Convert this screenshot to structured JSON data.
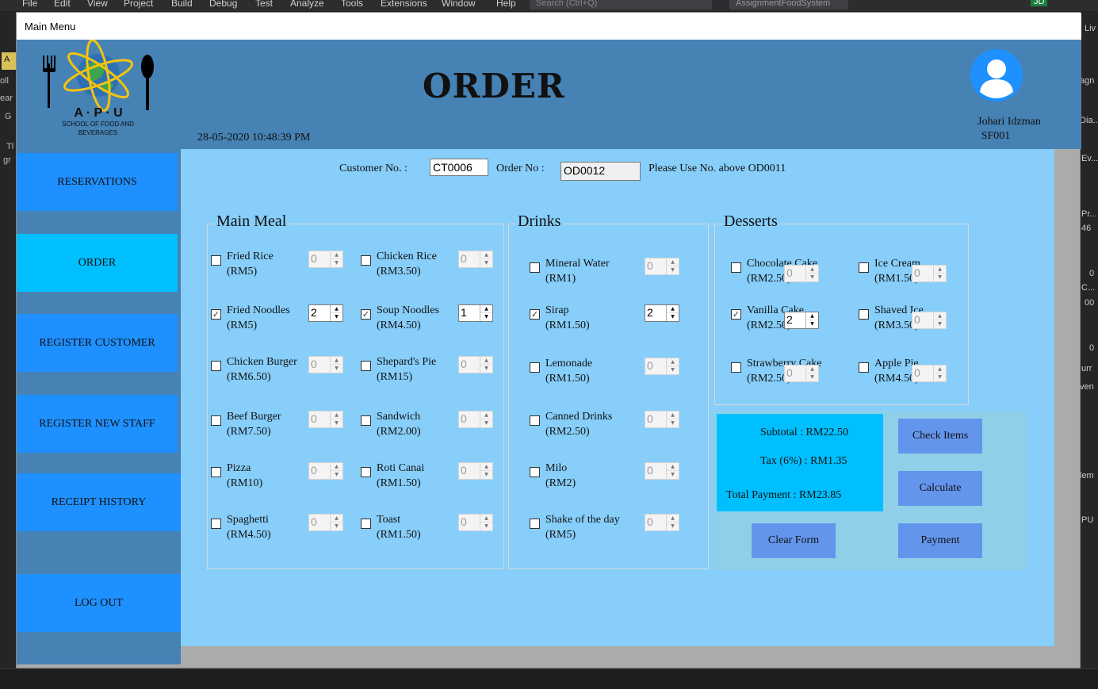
{
  "ide": {
    "menu": [
      "File",
      "Edit",
      "View",
      "Project",
      "Build",
      "Debug",
      "Test",
      "Analyze",
      "Tools",
      "Extensions",
      "Window",
      "Help"
    ],
    "search_placeholder": "Search (Ctrl+Q)",
    "project_name": "AssignmentFoodSystem",
    "user_initials": "JD",
    "left_fragments": [
      "A",
      "oll",
      "ear",
      "G",
      "Tl",
      "gr"
    ],
    "right_fragments": [
      "Liv",
      "agn",
      "Dia...",
      "Ev...",
      "Pr...",
      "46",
      "0",
      "C...",
      "00",
      "0",
      "urr",
      "ven",
      "lem",
      "PU"
    ]
  },
  "window": {
    "title": "Main Menu"
  },
  "header": {
    "logo_letters": "A · P · U",
    "logo_line1": "SCHOOL OF FOOD AND",
    "logo_line2": "BEVERAGES",
    "title": "ORDER",
    "datetime": "28-05-2020 10:48:39 PM",
    "user_name": "Johari Idzman",
    "user_id": "SF001"
  },
  "sidebar": {
    "items": [
      {
        "label": "RESERVATIONS",
        "active": false
      },
      {
        "label": "ORDER",
        "active": true
      },
      {
        "label": "REGISTER CUSTOMER",
        "active": false
      },
      {
        "label": "REGISTER NEW STAFF",
        "active": false
      },
      {
        "label": "RECEIPT HISTORY",
        "active": false
      },
      {
        "label": "LOG OUT",
        "active": false
      }
    ]
  },
  "order_info": {
    "customer_label": "Customer No. :",
    "customer_value": "CT0006",
    "order_label": "Order No :",
    "order_value": "OD0012",
    "hint": "Please Use No. above OD0011"
  },
  "main_meal": {
    "title": "Main Meal",
    "items": [
      {
        "name": "Fried Rice",
        "price": "(RM5)",
        "checked": false,
        "qty": "0"
      },
      {
        "name": "Chicken Rice",
        "price": "(RM3.50)",
        "checked": false,
        "qty": "0"
      },
      {
        "name": "Fried Noodles",
        "price": "(RM5)",
        "checked": true,
        "qty": "2"
      },
      {
        "name": "Soup Noodles",
        "price": "(RM4.50)",
        "checked": true,
        "qty": "1"
      },
      {
        "name": "Chicken Burger",
        "price": "(RM6.50)",
        "checked": false,
        "qty": "0"
      },
      {
        "name": "Shepard's Pie",
        "price": "(RM15)",
        "checked": false,
        "qty": "0"
      },
      {
        "name": "Beef Burger",
        "price": "(RM7.50)",
        "checked": false,
        "qty": "0"
      },
      {
        "name": "Sandwich",
        "price": "(RM2.00)",
        "checked": false,
        "qty": "0"
      },
      {
        "name": "Pizza",
        "price": "(RM10)",
        "checked": false,
        "qty": "0"
      },
      {
        "name": "Roti Canai",
        "price": "(RM1.50)",
        "checked": false,
        "qty": "0"
      },
      {
        "name": "Spaghetti",
        "price": "(RM4.50)",
        "checked": false,
        "qty": "0"
      },
      {
        "name": "Toast",
        "price": "(RM1.50)",
        "checked": false,
        "qty": "0"
      }
    ]
  },
  "drinks": {
    "title": "Drinks",
    "items": [
      {
        "name": "Mineral Water",
        "price": "(RM1)",
        "checked": false,
        "qty": "0"
      },
      {
        "name": "Sirap",
        "price": "(RM1.50)",
        "checked": true,
        "qty": "2"
      },
      {
        "name": "Lemonade",
        "price": "(RM1.50)",
        "checked": false,
        "qty": "0"
      },
      {
        "name": "Canned Drinks",
        "price": "(RM2.50)",
        "checked": false,
        "qty": "0"
      },
      {
        "name": "Milo",
        "price": "(RM2)",
        "checked": false,
        "qty": "0"
      },
      {
        "name": "Shake of the day",
        "price": "(RM5)",
        "checked": false,
        "qty": "0"
      }
    ]
  },
  "desserts": {
    "title": "Desserts",
    "items": [
      {
        "name": "Chocolate Cake",
        "price": "(RM2.50)",
        "checked": false,
        "qty": "0"
      },
      {
        "name": "Ice Cream",
        "price": "(RM1.50)",
        "checked": false,
        "qty": "0"
      },
      {
        "name": "Vanilla Cake",
        "price": "(RM2.50)",
        "checked": true,
        "qty": "2"
      },
      {
        "name": "Shaved Ice",
        "price": "(RM3.50)",
        "checked": false,
        "qty": "0"
      },
      {
        "name": "Strawberry Cake",
        "price": "(RM2.50)",
        "checked": false,
        "qty": "0"
      },
      {
        "name": "Apple Pie",
        "price": "(RM4.50)",
        "checked": false,
        "qty": "0"
      }
    ]
  },
  "summary": {
    "subtotal": "Subtotal : RM22.50",
    "tax": "Tax (6%) : RM1.35",
    "total": "Total Payment : RM23.85"
  },
  "buttons": {
    "check_items": "Check Items",
    "calculate": "Calculate",
    "clear_form": "Clear Form",
    "payment": "Payment"
  },
  "colors": {
    "header": "#4682b4",
    "content": "#87cefa",
    "nav_button": "#1e90ff",
    "nav_active": "#00bfff",
    "action_button": "#6495ed"
  }
}
